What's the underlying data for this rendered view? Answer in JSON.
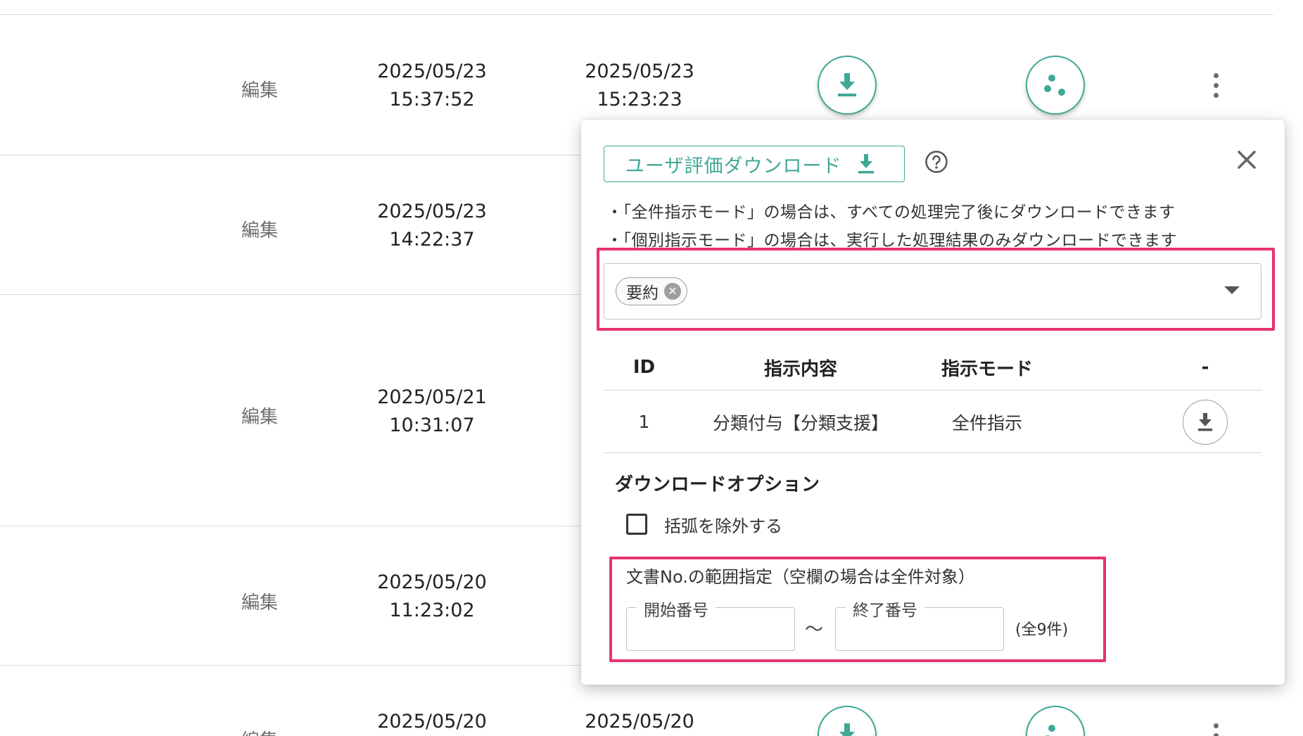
{
  "table": {
    "rows": [
      {
        "edit": "編集",
        "updated": [
          "2025/05/23",
          "15:37:52"
        ],
        "created": [
          "2025/05/23",
          "15:23:23"
        ]
      },
      {
        "edit": "編集",
        "updated": [
          "2025/05/23",
          "14:22:37"
        ]
      },
      {
        "edit": "編集",
        "updated": [
          "2025/05/21",
          "10:31:07"
        ]
      },
      {
        "edit": "編集",
        "updated": [
          "2025/05/20",
          "11:23:02"
        ]
      },
      {
        "edit": "編集",
        "updated": [
          "2025/05/20",
          ""
        ],
        "created": [
          "2025/05/20",
          ""
        ]
      }
    ]
  },
  "popover": {
    "download_button_label": "ユーザ評価ダウンロード",
    "notes": [
      "・「全件指示モード」の場合は、すべての処理完了後にダウンロードできます",
      "・「個別指示モード」の場合は、実行した処理結果のみダウンロードできます"
    ],
    "filter": {
      "chips": [
        "要約"
      ]
    },
    "instructions_table": {
      "headers": [
        "ID",
        "指示内容",
        "指示モード",
        "-"
      ],
      "rows": [
        {
          "id": "1",
          "content": "分類付与【分類支援】",
          "mode": "全件指示"
        }
      ]
    },
    "options": {
      "title": "ダウンロードオプション",
      "exclude_brackets_label": "括弧を除外する",
      "exclude_brackets_checked": false
    },
    "range": {
      "title": "文書No.の範囲指定（空欄の場合は全件対象）",
      "start_label": "開始番号",
      "end_label": "終了番号",
      "separator": "～",
      "start_value": "",
      "end_value": "",
      "total_label": "(全9件)"
    }
  },
  "colors": {
    "accent": "#3fa896",
    "highlight": "#e8336d"
  },
  "icons": [
    "download-icon",
    "share-nodes-icon",
    "more-vert-icon",
    "help-icon",
    "close-icon",
    "chip-remove-icon",
    "dropdown-arrow-icon"
  ]
}
